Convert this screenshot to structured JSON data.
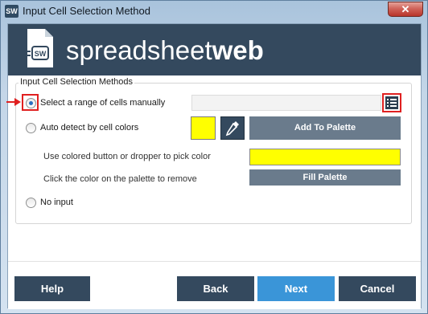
{
  "window": {
    "icon_text": "SW",
    "title": "Input Cell Selection Method",
    "close_label": "✕"
  },
  "header": {
    "logo_icon_text": "SW",
    "brand_light": "spreadsheet",
    "brand_bold": "web",
    "bg_color": "#34495e"
  },
  "group": {
    "legend": "Input Cell Selection Methods",
    "options": [
      {
        "label": "Select a range of cells manually",
        "checked": true
      },
      {
        "label": "Auto detect by cell colors",
        "checked": false
      },
      {
        "label": "No input",
        "checked": false
      }
    ],
    "range_input_value": "",
    "range_picker_icon": "list-select-icon",
    "selected_color": "#ffff00",
    "dropper_icon": "eyedropper-icon",
    "add_to_palette_label": "Add To Palette",
    "hint_pick": "Use colored button or dropper to pick color",
    "hint_remove": "Click the color on the palette to remove",
    "palette_color": "#ffff00",
    "fill_palette_label": "Fill Palette"
  },
  "footer": {
    "help_label": "Help",
    "back_label": "Back",
    "next_label": "Next",
    "cancel_label": "Cancel"
  },
  "colors": {
    "accent_blue": "#3a95d8",
    "dark": "#34495e",
    "annotation_red": "#e02020"
  }
}
